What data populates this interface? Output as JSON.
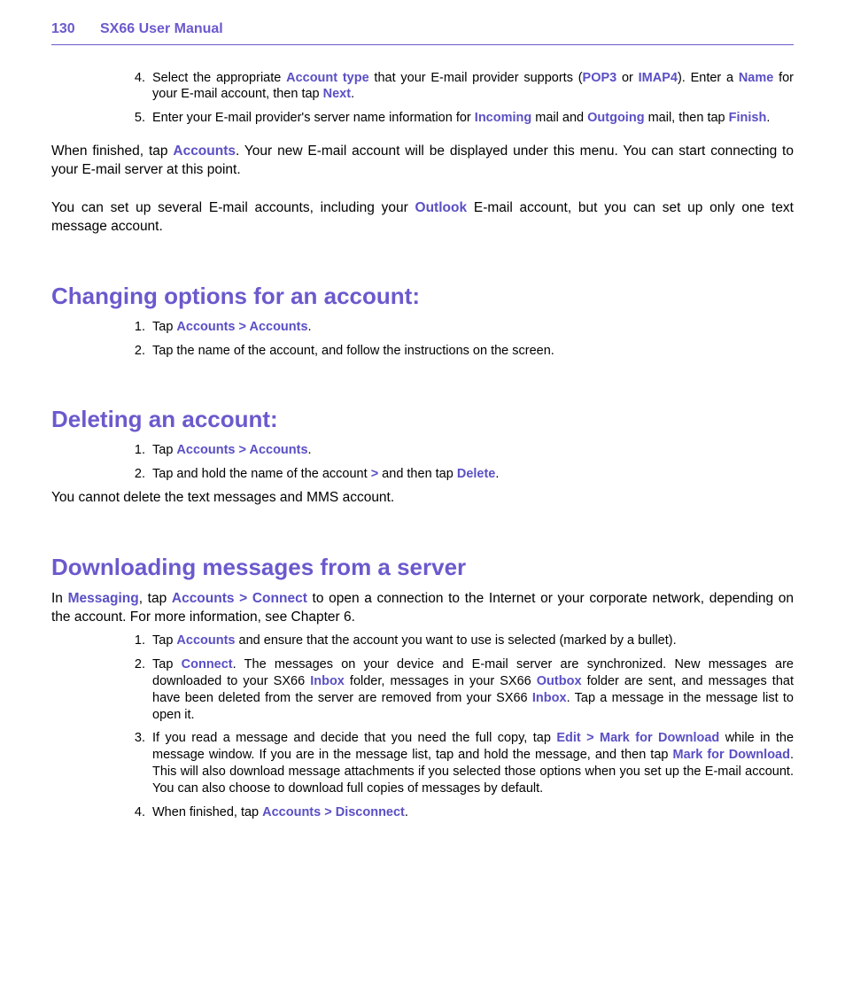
{
  "header": {
    "page_number": "130",
    "title": "SX66 User Manual"
  },
  "intro_list": [
    {
      "pre": "Select the appropriate ",
      "k1": "Account type",
      "mid1": " that your E-mail provider supports (",
      "k2": "POP3",
      "mid2": " or ",
      "k3": "IMAP4",
      "mid3": "). Enter a ",
      "k4": "Name",
      "mid4": " for your E-mail account, then tap ",
      "k5": "Next",
      "post": "."
    },
    {
      "pre": "Enter your E-mail provider's server name information for ",
      "k1": "Incoming",
      "mid1": " mail and ",
      "k2": "Outgoing",
      "mid2": " mail, then tap ",
      "k3": "Finish",
      "post": "."
    }
  ],
  "para1": {
    "pre": "When finished, tap ",
    "k1": "Accounts",
    "post": ". Your new E-mail account will be displayed under this menu. You can start connecting to your E-mail server at this point."
  },
  "para2": {
    "pre": "You can set up several E-mail accounts, including your ",
    "k1": "Outlook",
    "post": " E-mail account, but you can set up only one text message account."
  },
  "sec1": {
    "title": "Changing options for an account:",
    "items": [
      {
        "pre": "Tap ",
        "k1": "Accounts > Accounts",
        "post": "."
      },
      {
        "pre": "Tap the name of the account, and follow the instructions on the screen.",
        "post": ""
      }
    ]
  },
  "sec2": {
    "title": "Deleting an account:",
    "items": [
      {
        "pre": "Tap ",
        "k1": "Accounts > Accounts",
        "post": "."
      },
      {
        "pre": "Tap and hold the name of the account ",
        "k1": ">",
        "mid1": " and then tap ",
        "k2": "Delete",
        "post": "."
      }
    ],
    "note": "You cannot delete the text messages and MMS account."
  },
  "sec3": {
    "title": "Downloading messages from a server",
    "intro": {
      "pre": "In ",
      "k1": "Messaging",
      "mid1": ", tap ",
      "k2": "Accounts > Connect",
      "post": " to open a connection to the Internet or your corporate network, depending on the account. For more information, see Chapter 6."
    },
    "items": [
      {
        "pre": "Tap ",
        "k1": "Accounts",
        "post": " and ensure that the account you want to use is selected (marked by a bullet)."
      },
      {
        "pre": "Tap ",
        "k1": "Connect",
        "mid1": ". The messages on your device and E-mail server are synchronized. New messages are downloaded to your SX66 ",
        "k2": "Inbox",
        "mid2": " folder, messages in your SX66 ",
        "k3": "Outbox",
        "mid3": " folder are sent, and messages that have been deleted from the server are removed from your SX66 ",
        "k4": "Inbox",
        "post": ". Tap a message in the message list to open it."
      },
      {
        "pre": "If you read a message and decide that you need the full copy, tap ",
        "k1": "Edit > Mark for Download",
        "mid1": " while in the message window. If you are in the message list, tap and hold the message, and then tap ",
        "k2": "Mark for Download",
        "post": ". This will also download message attachments if you selected those options when you set up the E-mail account. You can also choose to download full copies of messages by default."
      },
      {
        "pre": "When finished, tap ",
        "k1": "Accounts > Disconnect",
        "post": "."
      }
    ]
  }
}
